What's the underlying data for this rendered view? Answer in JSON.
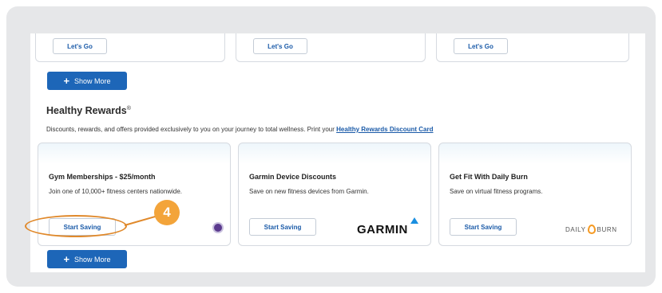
{
  "top_cards": [
    {
      "button_label": "Let's Go"
    },
    {
      "button_label": "Let's Go"
    },
    {
      "button_label": "Let's Go"
    }
  ],
  "show_more_label": "Show More",
  "section": {
    "title": "Healthy Rewards",
    "title_mark": "®",
    "description": "Discounts, rewards, and offers provided exclusively to you on your journey to total wellness. Print your ",
    "link_text": "Healthy Rewards Discount Card"
  },
  "cards": [
    {
      "title": "Gym Memberships - $25/month",
      "description": "Join one of 10,000+ fitness centers nationwide.",
      "button_label": "Start Saving",
      "logo": "gym-badge-logo"
    },
    {
      "title": "Garmin Device Discounts",
      "description": "Save on new fitness devices from Garmin.",
      "button_label": "Start Saving",
      "logo_text": "GARMIN"
    },
    {
      "title": "Get Fit With Daily Burn",
      "description": "Save on virtual fitness programs.",
      "button_label": "Start Saving",
      "logo_text_left": "DAILY",
      "logo_text_right": "BURN"
    }
  ],
  "annotation": {
    "number": "4",
    "color": "#f3a43a"
  },
  "colors": {
    "primary": "#1d66b8",
    "link": "#1a5aa8",
    "annotation": "#e0892b"
  }
}
